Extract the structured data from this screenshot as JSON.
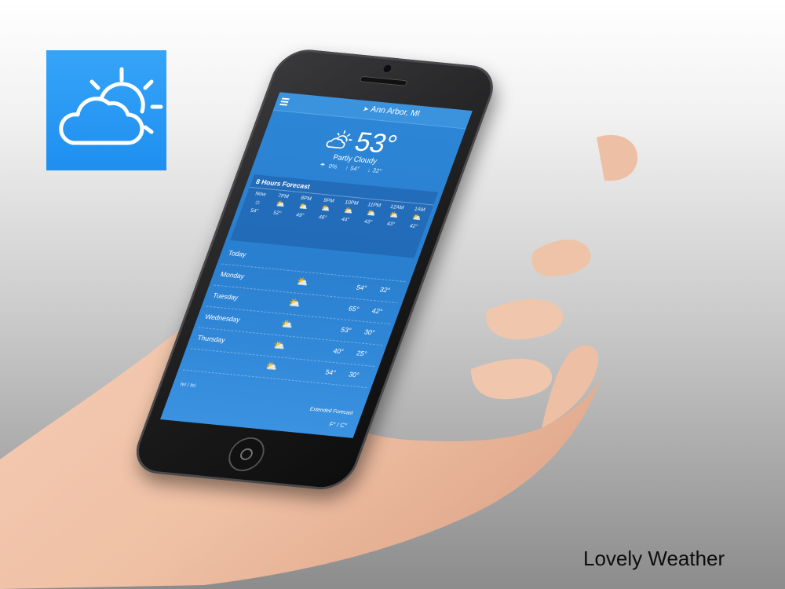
{
  "app_icon": {
    "name": "partly-cloudy-icon",
    "bg": "#2396f1"
  },
  "phone": {
    "location": "Ann Arbor, MI",
    "current": {
      "temp": "53°",
      "condition": "Partly Cloudy",
      "precip": "0%",
      "high": "54°",
      "low": "32°"
    },
    "hourly": {
      "title": "8 Hours Forecast",
      "items": [
        {
          "time": "Now",
          "icon": "sun-icon",
          "glyph": "☼",
          "temp": "54°"
        },
        {
          "time": "7PM",
          "icon": "partly-cloudy-icon",
          "glyph": "⛅",
          "temp": "52°"
        },
        {
          "time": "8PM",
          "icon": "partly-cloudy-icon",
          "glyph": "⛅",
          "temp": "49°"
        },
        {
          "time": "9PM",
          "icon": "partly-cloudy-icon",
          "glyph": "⛅",
          "temp": "46°"
        },
        {
          "time": "10PM",
          "icon": "partly-cloudy-icon",
          "glyph": "⛅",
          "temp": "44°"
        },
        {
          "time": "11PM",
          "icon": "partly-cloudy-icon",
          "glyph": "⛅",
          "temp": "43°"
        },
        {
          "time": "12AM",
          "icon": "partly-cloudy-icon",
          "glyph": "⛅",
          "temp": "43°"
        },
        {
          "time": "1AM",
          "icon": "partly-cloudy-icon",
          "glyph": "⛅",
          "temp": "42°"
        }
      ]
    },
    "daily": [
      {
        "day": "Today",
        "icon": "partly-cloudy-icon",
        "glyph": "",
        "hi": "",
        "lo": ""
      },
      {
        "day": "Monday",
        "icon": "partly-cloudy-icon",
        "glyph": "⛅",
        "hi": "54°",
        "lo": "32°"
      },
      {
        "day": "Tuesday",
        "icon": "partly-cloudy-icon",
        "glyph": "⛅",
        "hi": "65°",
        "lo": "42°"
      },
      {
        "day": "Wednesday",
        "icon": "partly-cloudy-icon",
        "glyph": "⛅",
        "hi": "53°",
        "lo": "30°"
      },
      {
        "day": "Thursday",
        "icon": "partly-cloudy-icon",
        "glyph": "⛅",
        "hi": "40°",
        "lo": "25°"
      },
      {
        "day": "",
        "icon": "partly-cloudy-icon",
        "glyph": "⛅",
        "hi": "54°",
        "lo": "30°"
      }
    ],
    "units_left": "fel / fel",
    "extended_forecast": "Extended Forecast",
    "units_toggle": "F° / C°",
    "colors": {
      "screen": "#2d86d6",
      "topbar": "#3b93de"
    }
  },
  "caption": "Lovely Weather"
}
